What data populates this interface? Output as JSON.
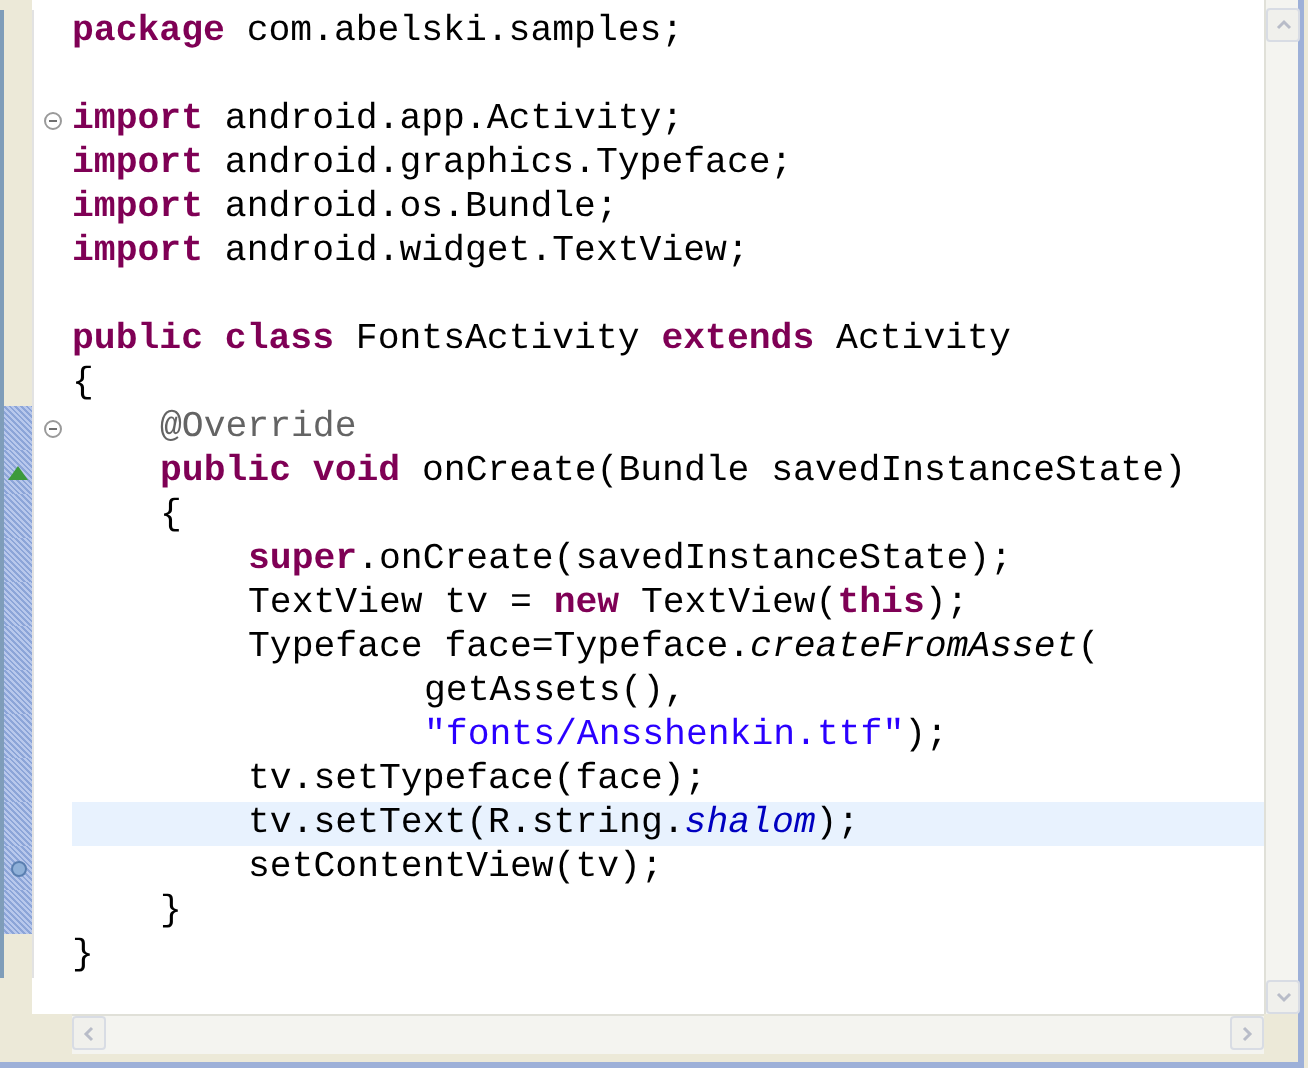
{
  "editor": {
    "lines": [
      {
        "tokens": [
          {
            "kind": "keyword",
            "text": "package"
          },
          {
            "kind": "plain",
            "text": " com.abelski.samples;"
          }
        ],
        "fold": false,
        "in_range": false,
        "current": false,
        "overrides": false,
        "breakpoint": false
      },
      {
        "fold": false,
        "in_range": false,
        "current": false,
        "overrides": false,
        "breakpoint": false
      },
      {
        "tokens": [
          {
            "kind": "keyword",
            "text": "import"
          },
          {
            "kind": "plain",
            "text": " android.app.Activity;"
          }
        ],
        "fold": true,
        "in_range": false,
        "current": false,
        "overrides": false,
        "breakpoint": false
      },
      {
        "tokens": [
          {
            "kind": "keyword",
            "text": "import"
          },
          {
            "kind": "plain",
            "text": " android.graphics.Typeface;"
          }
        ],
        "fold": false,
        "in_range": false,
        "current": false,
        "overrides": false,
        "breakpoint": false
      },
      {
        "tokens": [
          {
            "kind": "keyword",
            "text": "import"
          },
          {
            "kind": "plain",
            "text": " android.os.Bundle;"
          }
        ],
        "fold": false,
        "in_range": false,
        "current": false,
        "overrides": false,
        "breakpoint": false
      },
      {
        "tokens": [
          {
            "kind": "keyword",
            "text": "import"
          },
          {
            "kind": "plain",
            "text": " android.widget.TextView;"
          }
        ],
        "fold": false,
        "in_range": false,
        "current": false,
        "overrides": false,
        "breakpoint": false
      },
      {
        "fold": false,
        "in_range": false,
        "current": false,
        "overrides": false,
        "breakpoint": false
      },
      {
        "tokens": [
          {
            "kind": "keyword",
            "text": "public"
          },
          {
            "kind": "keyword",
            "text": " class"
          },
          {
            "kind": "plain",
            "text": " FontsActivity "
          },
          {
            "kind": "keyword",
            "text": "extends"
          },
          {
            "kind": "plain",
            "text": " Activity"
          }
        ],
        "fold": false,
        "in_range": false,
        "current": false,
        "overrides": false,
        "breakpoint": false
      },
      {
        "tokens": [
          {
            "kind": "plain",
            "text": "{"
          }
        ],
        "fold": false,
        "in_range": false,
        "current": false,
        "overrides": false,
        "breakpoint": false,
        "children": [
          {
            "tokens": [
              {
                "kind": "annotation",
                "text": "@Override"
              }
            ],
            "fold": true,
            "in_range": true,
            "current": false,
            "overrides": false,
            "breakpoint": false
          },
          {
            "tokens": [
              {
                "kind": "keyword",
                "text": "public"
              },
              {
                "kind": "keyword",
                "text": " void"
              },
              {
                "kind": "plain",
                "text": " onCreate(Bundle savedInstanceState)"
              }
            ],
            "fold": false,
            "in_range": true,
            "current": false,
            "overrides": true,
            "breakpoint": false
          },
          {
            "tokens": [
              {
                "kind": "plain",
                "text": "{"
              }
            ],
            "fold": false,
            "in_range": true,
            "current": false,
            "overrides": false,
            "breakpoint": false,
            "children": [
              {
                "tokens": [
                  {
                    "kind": "keyword",
                    "text": "super"
                  },
                  {
                    "kind": "plain",
                    "text": ".onCreate(savedInstanceState);"
                  }
                ],
                "fold": false,
                "in_range": true,
                "current": false,
                "overrides": false,
                "breakpoint": false
              },
              {
                "tokens": [
                  {
                    "kind": "plain",
                    "text": "TextView tv = "
                  },
                  {
                    "kind": "keyword",
                    "text": "new"
                  },
                  {
                    "kind": "plain",
                    "text": " TextView("
                  },
                  {
                    "kind": "keyword",
                    "text": "this"
                  },
                  {
                    "kind": "plain",
                    "text": ");"
                  }
                ],
                "fold": false,
                "in_range": true,
                "current": false,
                "overrides": false,
                "breakpoint": false
              },
              {
                "tokens": [
                  {
                    "kind": "plain",
                    "text": "Typeface face=Typeface."
                  },
                  {
                    "kind": "static",
                    "text": "createFromAsset"
                  },
                  {
                    "kind": "plain",
                    "text": "("
                  }
                ],
                "fold": false,
                "in_range": true,
                "current": false,
                "overrides": false,
                "breakpoint": false,
                "children": [
                  {
                    "tokens": [
                      {
                        "kind": "plain",
                        "text": "getAssets(),"
                      }
                    ],
                    "fold": false,
                    "in_range": true,
                    "current": false,
                    "overrides": false,
                    "breakpoint": false,
                    "continuation": true
                  },
                  {
                    "tokens": [
                      {
                        "kind": "string",
                        "text": "\"fonts/Ansshenkin.ttf\""
                      },
                      {
                        "kind": "plain",
                        "text": ");"
                      }
                    ],
                    "fold": false,
                    "in_range": true,
                    "current": false,
                    "overrides": false,
                    "breakpoint": false,
                    "continuation": true
                  }
                ]
              },
              {
                "tokens": [
                  {
                    "kind": "plain",
                    "text": "tv.setTypeface(face);"
                  }
                ],
                "fold": false,
                "in_range": true,
                "current": false,
                "overrides": false,
                "breakpoint": false
              },
              {
                "tokens": [
                  {
                    "kind": "plain",
                    "text": "tv.setText(R.string."
                  },
                  {
                    "kind": "field",
                    "text": "shalom"
                  },
                  {
                    "kind": "plain",
                    "text": ");"
                  }
                ],
                "fold": false,
                "in_range": true,
                "current": true,
                "overrides": false,
                "breakpoint": false
              },
              {
                "tokens": [
                  {
                    "kind": "plain",
                    "text": "setContentView(tv);"
                  }
                ],
                "fold": false,
                "in_range": true,
                "current": false,
                "overrides": false,
                "breakpoint": true
              }
            ]
          },
          {
            "tokens": [
              {
                "kind": "plain",
                "text": "}"
              }
            ],
            "fold": false,
            "in_range": true,
            "current": false,
            "overrides": false,
            "breakpoint": false
          }
        ]
      },
      {
        "tokens": [
          {
            "kind": "plain",
            "text": "}"
          }
        ],
        "fold": false,
        "in_range": false,
        "current": false,
        "overrides": false,
        "breakpoint": false
      }
    ]
  }
}
